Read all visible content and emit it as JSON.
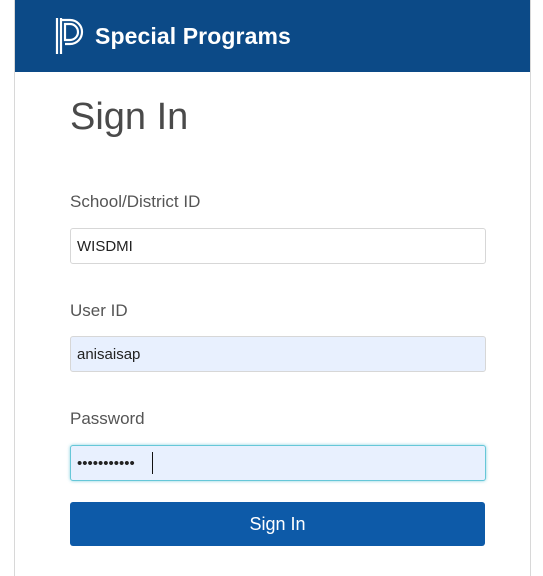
{
  "header": {
    "brand": "Special Programs",
    "logo_icon": "powerschool-logo-icon",
    "bg_color": "#0c4a87"
  },
  "page": {
    "title": "Sign In"
  },
  "form": {
    "school_label": "School/District ID",
    "school_value": "WISDMI",
    "user_label": "User ID",
    "user_value": "anisaisap",
    "password_label": "Password",
    "password_value": "•••••••••••",
    "submit_label": "Sign In",
    "submit_color": "#0d5aa8"
  }
}
